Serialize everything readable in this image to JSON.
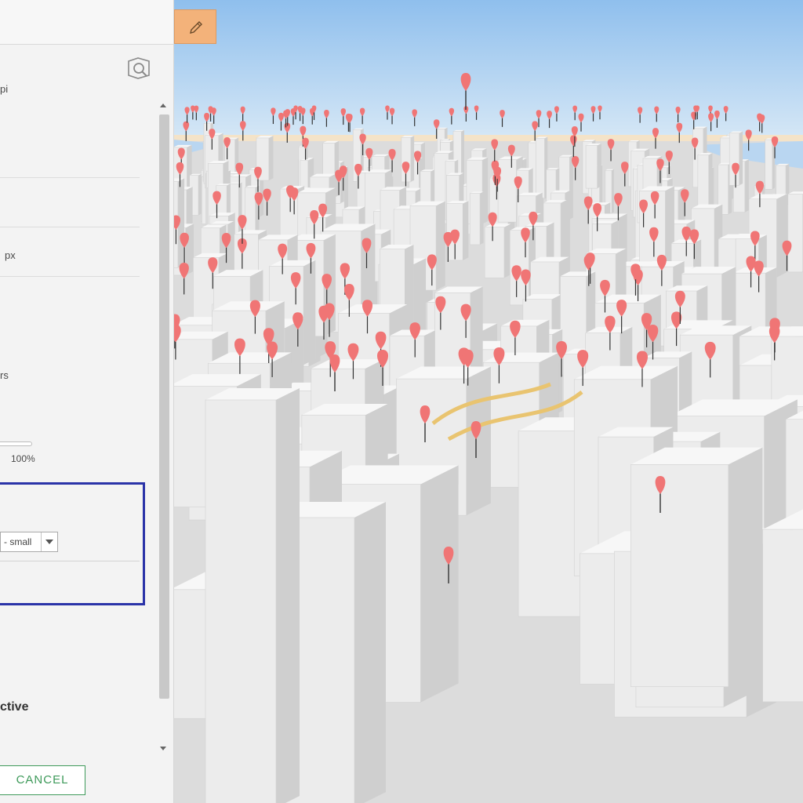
{
  "panel": {
    "fragments": {
      "dpi": "pi",
      "px": "px",
      "layers": "rs",
      "opacity": "100%",
      "size_value": "- small",
      "active": "ctive"
    },
    "cancel_label": "CANCEL",
    "icons": {
      "layer_icon": "layer-search-icon",
      "dropdown_icon": "chevron-down-icon",
      "scroll_up_icon": "arrow-up-icon",
      "scroll_down_icon": "arrow-down-icon"
    },
    "colors": {
      "highlight_border": "#2a33a8",
      "cancel_accent": "#3e9a5a"
    }
  },
  "map": {
    "view": "3D city scene",
    "edit_icon": "pencil-icon",
    "edit_button_color": "#f3b27a",
    "pin_color": "#f07575",
    "building_color": "#ececec",
    "sky_color": "#9ec8ee"
  }
}
